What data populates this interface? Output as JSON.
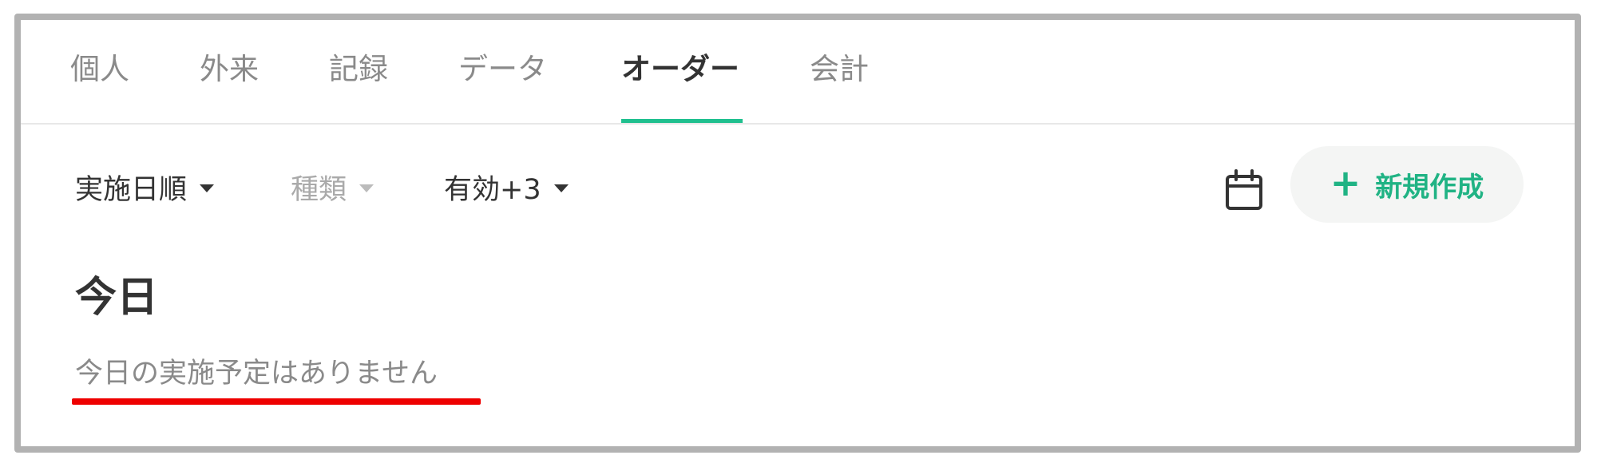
{
  "tabs": {
    "items": [
      {
        "label": "個人"
      },
      {
        "label": "外来"
      },
      {
        "label": "記録"
      },
      {
        "label": "データ"
      },
      {
        "label": "オーダー",
        "active": true
      },
      {
        "label": "会計"
      }
    ]
  },
  "toolbar": {
    "sort": {
      "label": "実施日順"
    },
    "type": {
      "label": "種類",
      "disabled": true
    },
    "status": {
      "label": "有効+3"
    },
    "calendar_icon": "calendar-icon",
    "new_button": {
      "icon": "plus-icon",
      "label": "新規作成"
    }
  },
  "section": {
    "title": "今日",
    "empty_message": "今日の実施予定はありません"
  },
  "colors": {
    "accent": "#20c08f",
    "highlight_underline": "#ee0000",
    "frame_border": "#b2b2b2"
  }
}
